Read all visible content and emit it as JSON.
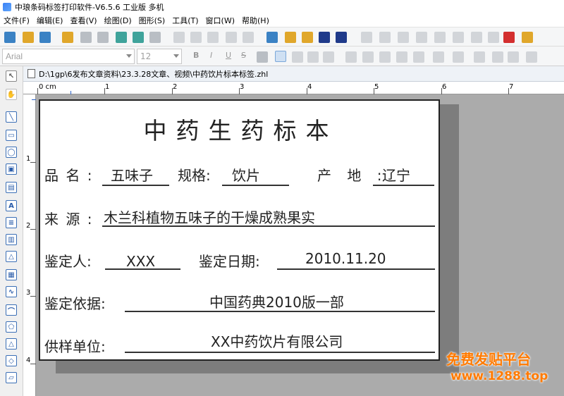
{
  "window": {
    "title": "中琅条码标签打印软件-V6.5.6 工业版 多机"
  },
  "menu": [
    "文件(F)",
    "编辑(E)",
    "查看(V)",
    "绘图(D)",
    "图形(S)",
    "工具(T)",
    "窗口(W)",
    "帮助(H)"
  ],
  "format_bar": {
    "font_name": "Arial",
    "font_size": "12",
    "bold": "B",
    "italic": "I",
    "underline": "U",
    "strike": "S"
  },
  "document": {
    "tab_title": "D:\\1gp\\6发布文章资料\\23.3.28文章、视频\\中药饮片标本标签.zhl"
  },
  "ruler": {
    "unit_label": "0 cm",
    "top_numbers": [
      "1",
      "2",
      "3",
      "4",
      "5",
      "6",
      "7"
    ],
    "left_numbers": [
      "1",
      "2",
      "3",
      "4"
    ]
  },
  "label": {
    "title": "中药生药标本",
    "row1": {
      "name_label": "品 名 :",
      "name_value": "五味子",
      "spec_label": "规格:",
      "spec_value": "饮片",
      "origin_label": "产 地 :",
      "origin_value": "辽宁"
    },
    "row2": {
      "source_label": "来 源 :",
      "source_value": "木兰科植物五味子的干燥成熟果实"
    },
    "row3": {
      "identifier_label": "鉴定人:",
      "identifier_value": "XXX",
      "date_label": "鉴定日期:",
      "date_value": "2010.11.20"
    },
    "row4": {
      "basis_label": "鉴定依据:",
      "basis_value": "中国药典2010版一部"
    },
    "row5": {
      "supplier_label": "供样单位:",
      "supplier_value": "XX中药饮片有限公司"
    }
  },
  "watermark": {
    "line1": "免费发贴平台",
    "line2": "www.1288.top"
  },
  "colors": {
    "watermark": "#ff7a00",
    "canvas": "#ababab",
    "label_border": "#222222"
  }
}
